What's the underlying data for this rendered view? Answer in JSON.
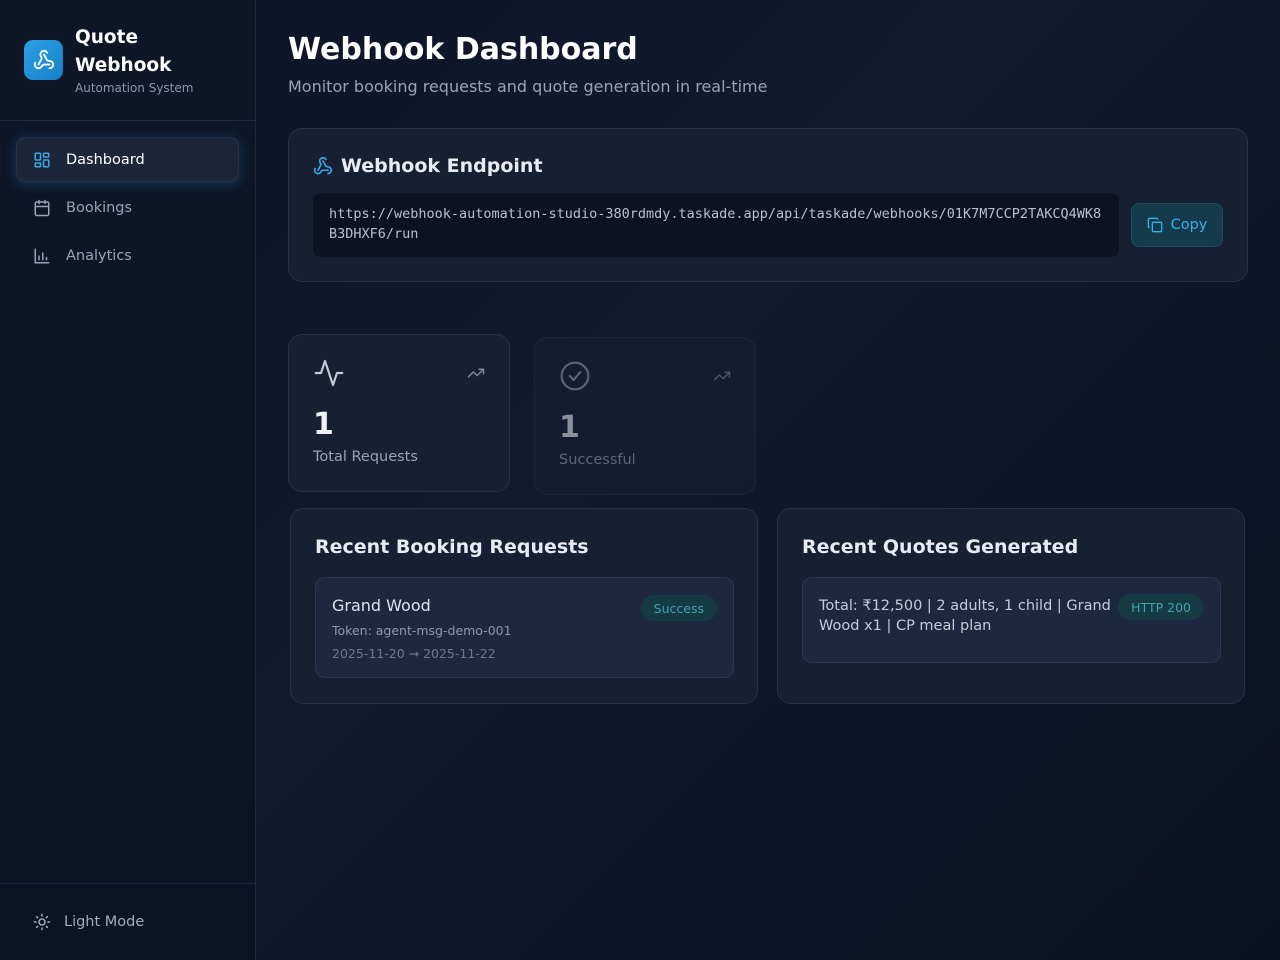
{
  "brand": {
    "title": "Quote Webhook",
    "subtitle": "Automation System",
    "logo_icon": "webhook-icon",
    "accent": "#2496dc"
  },
  "nav": {
    "items": [
      {
        "label": "Dashboard",
        "icon": "dashboard-icon",
        "active": true
      },
      {
        "label": "Bookings",
        "icon": "calendar-icon",
        "active": false
      },
      {
        "label": "Analytics",
        "icon": "bar-chart-icon",
        "active": false
      }
    ]
  },
  "footer": {
    "theme_toggle_label": "Light Mode",
    "icon": "sun-icon"
  },
  "page": {
    "title": "Webhook Dashboard",
    "subtitle": "Monitor booking requests and quote generation in real-time"
  },
  "endpoint": {
    "title": "Webhook Endpoint",
    "url": "https://webhook-automation-studio-380rdmdy.taskade.app/api/taskade/webhooks/01K7M7CCP2TAKCQ4WK8B3DHXF6/run",
    "copy_label": "Copy"
  },
  "stats": [
    {
      "value": "1",
      "label": "Total Requests",
      "icon": "activity-icon",
      "trend_icon": "trending-up-icon"
    },
    {
      "value": "1",
      "label": "Successful",
      "icon": "check-circle-icon",
      "trend_icon": "trending-up-icon"
    }
  ],
  "bookings": {
    "title": "Recent Booking Requests",
    "items": [
      {
        "name": "Grand Wood",
        "token": "Token: agent-msg-demo-001",
        "dates": "2025-11-20 → 2025-11-22",
        "status": "Success"
      }
    ]
  },
  "quotes": {
    "title": "Recent Quotes Generated",
    "items": [
      {
        "summary": "Total: ₹12,500 | 2 adults, 1 child | Grand Wood x1 | CP meal plan",
        "status": "HTTP 200"
      }
    ]
  }
}
